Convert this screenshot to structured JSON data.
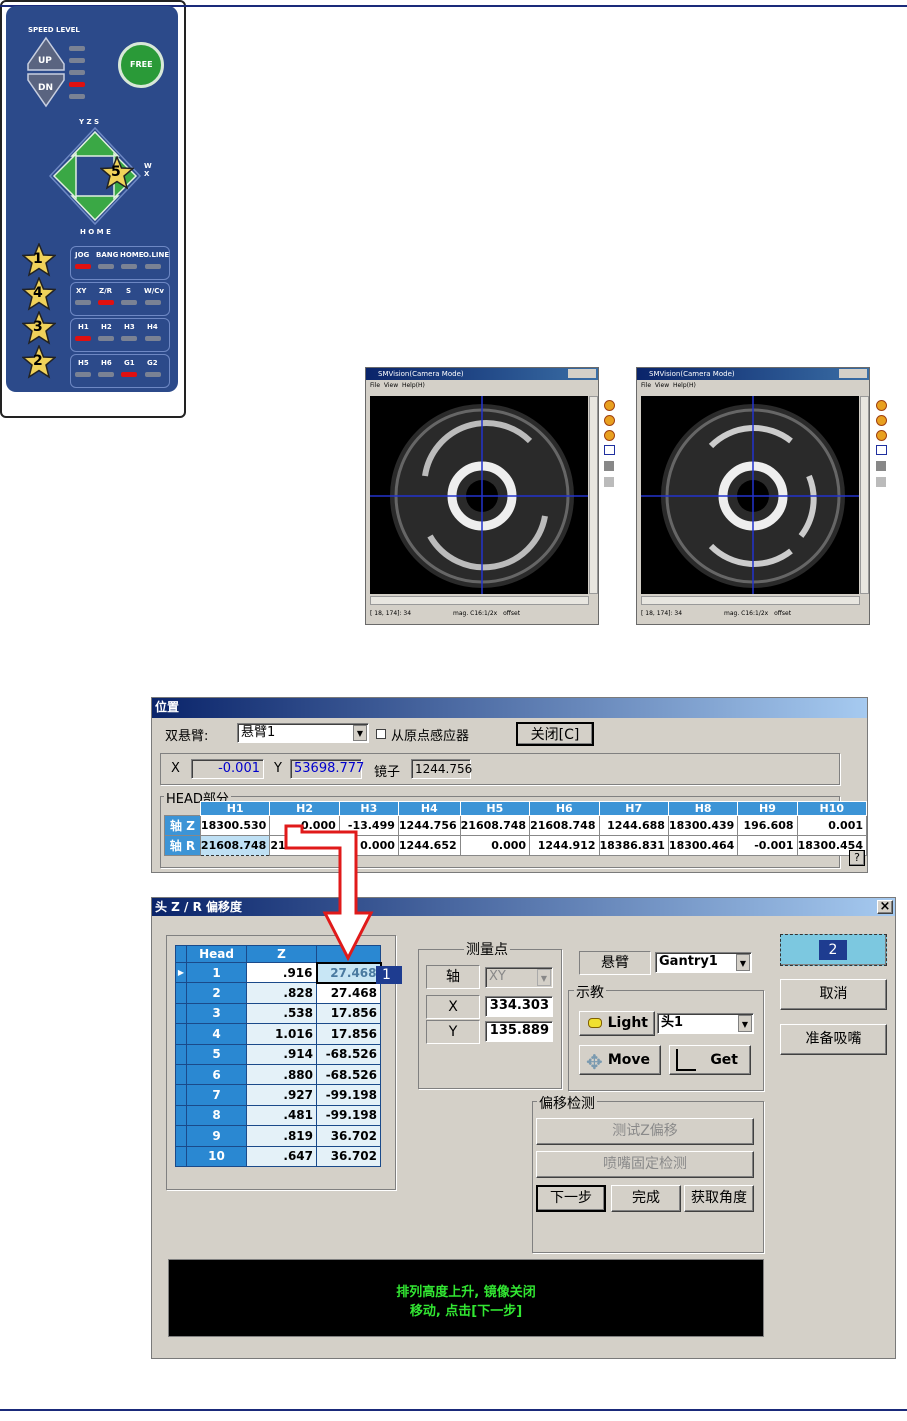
{
  "remote": {
    "speed_level": "SPEED LEVEL",
    "up": "UP",
    "dn": "DN",
    "free": "FREE",
    "axis_top": "Y Z S",
    "axis_right": "W X",
    "home": "H O M E",
    "row1": [
      "JOG",
      "BANG",
      "HOME",
      "O.LINE"
    ],
    "row2": [
      "XY",
      "Z/R",
      "S",
      "W/Cv"
    ],
    "row3": [
      "H1",
      "H2",
      "H3",
      "H4"
    ],
    "row4": [
      "H5",
      "H6",
      "G1",
      "G2"
    ],
    "stars": [
      "1",
      "4",
      "3",
      "2",
      "5"
    ]
  },
  "smv": [
    {
      "title": "SMVision(Camera Mode)",
      "menu": [
        "File",
        "View",
        "Help(H)"
      ],
      "status": "[ 18, 174]: 34",
      "mag": "mag.  C16:1/2x",
      "offset": "offset"
    },
    {
      "title": "SMVision(Camera Mode)",
      "menu": [
        "File",
        "View",
        "Help(H)"
      ],
      "status": "[ 18, 174]: 34",
      "mag": "mag.  C16:1/2x",
      "offset": "offset"
    }
  ],
  "position": {
    "title": "位置",
    "dual_label": "双悬臂:",
    "dual_value": "悬臂1",
    "origin_sensor": "从原点感应器",
    "close": "关闭[C]",
    "x_label": "X",
    "x_value": "-0.001",
    "y_label": "Y",
    "y_value": "53698.777",
    "mirror_label": "镜子",
    "mirror_value": "1244.756",
    "head_group": "HEAD部分",
    "heads": [
      "H1",
      "H2",
      "H3",
      "H4",
      "H5",
      "H6",
      "H7",
      "H8",
      "H9",
      "H10"
    ],
    "axis_z_label": "轴 Z",
    "axis_r_label": "轴 R",
    "axis_z": [
      "18300.530",
      "0.000",
      "-13.499",
      "1244.756",
      "21608.748",
      "21608.748",
      "1244.688",
      "18300.439",
      "196.608",
      "0.001"
    ],
    "axis_r": [
      "21608.748",
      "21608.748",
      "0.000",
      "1244.652",
      "0.000",
      "1244.912",
      "18386.831",
      "18300.464",
      "-0.001",
      "18300.454"
    ],
    "help": "?"
  },
  "offset_dialog": {
    "title": "头 Z / R 偏移度",
    "close": "×",
    "columns": [
      "Head",
      "Z",
      "R"
    ],
    "rows": [
      {
        "head": "1",
        "z": ".916",
        "r": "27.468"
      },
      {
        "head": "2",
        "z": ".828",
        "r": "27.468"
      },
      {
        "head": "3",
        "z": ".538",
        "r": "17.856"
      },
      {
        "head": "4",
        "z": "1.016",
        "r": "17.856"
      },
      {
        "head": "5",
        "z": ".914",
        "r": "-68.526"
      },
      {
        "head": "6",
        "z": ".880",
        "r": "-68.526"
      },
      {
        "head": "7",
        "z": ".927",
        "r": "-99.198"
      },
      {
        "head": "8",
        "z": ".481",
        "r": "-99.198"
      },
      {
        "head": "9",
        "z": ".819",
        "r": "36.702"
      },
      {
        "head": "10",
        "z": ".647",
        "r": "36.702"
      }
    ],
    "marker1": "1",
    "marker2": "2",
    "measure_group": "测量点",
    "axis_label": "轴",
    "axis_value": "XY",
    "x_label": "X",
    "x_value": "334.303",
    "y_label": "Y",
    "y_value": "135.889",
    "gantry_label": "悬臂",
    "gantry_value": "Gantry1",
    "teach_group": "示教",
    "light": "Light",
    "head_value": "头1",
    "move": "Move",
    "get": "Get",
    "offset_check_group": "偏移检测",
    "test_z": "测试Z偏移",
    "nozzle_check": "喷嘴固定检测",
    "next": "下一步",
    "done": "完成",
    "get_angle": "获取角度",
    "cancel": "取消",
    "prepare": "准备吸嘴",
    "message_line1": "排列高度上升, 镜像关闭",
    "message_line2": "移动, 点击[下一步]",
    "message_color": "#32e632"
  }
}
